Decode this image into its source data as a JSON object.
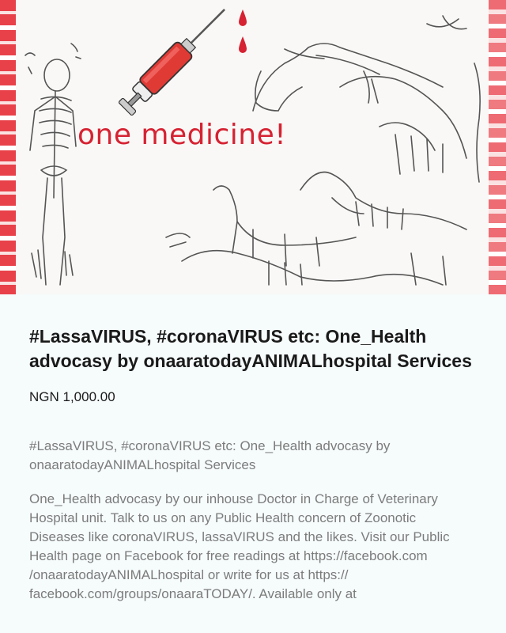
{
  "banner": {
    "slogan": "one medicine!",
    "colors": {
      "stripe": "#e8414a",
      "syringe": "#e03a35",
      "text": "#d62232"
    },
    "icons": [
      "syringe-icon",
      "blood-drop-icon",
      "skeleton-illustration"
    ]
  },
  "product": {
    "title": "#LassaVIRUS, #coronaVIRUS etc: One_Health advocasy by onaaratodayANIMALhospital Services",
    "price": "NGN 1,000.00",
    "subtitle": "#LassaVIRUS, #coronaVIRUS etc: One_Health advocasy by onaaratodayANIMALhospital Services",
    "description": "One_Health advocasy by our inhouse Doctor in Charge of Veterinary Hospital unit. Talk to us on any Public Health concern of Zoonotic Diseases like coronaVIRUS, lassaVIRUS and the likes. Visit our Public Health page on Facebook for free readings at https://facebook.com /onaaratodayANIMALhospital or write for us at https:// facebook.com/groups/onaaraTODAY/. Available only at"
  }
}
